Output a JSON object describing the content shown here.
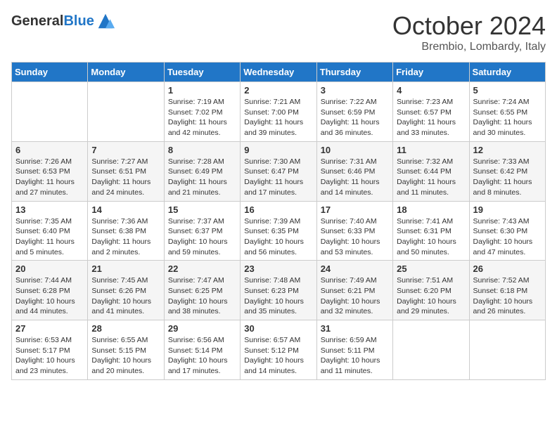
{
  "logo": {
    "general": "General",
    "blue": "Blue"
  },
  "title": "October 2024",
  "location": "Brembio, Lombardy, Italy",
  "days_of_week": [
    "Sunday",
    "Monday",
    "Tuesday",
    "Wednesday",
    "Thursday",
    "Friday",
    "Saturday"
  ],
  "weeks": [
    [
      {
        "day": "",
        "info": ""
      },
      {
        "day": "",
        "info": ""
      },
      {
        "day": "1",
        "info": "Sunrise: 7:19 AM\nSunset: 7:02 PM\nDaylight: 11 hours and 42 minutes."
      },
      {
        "day": "2",
        "info": "Sunrise: 7:21 AM\nSunset: 7:00 PM\nDaylight: 11 hours and 39 minutes."
      },
      {
        "day": "3",
        "info": "Sunrise: 7:22 AM\nSunset: 6:59 PM\nDaylight: 11 hours and 36 minutes."
      },
      {
        "day": "4",
        "info": "Sunrise: 7:23 AM\nSunset: 6:57 PM\nDaylight: 11 hours and 33 minutes."
      },
      {
        "day": "5",
        "info": "Sunrise: 7:24 AM\nSunset: 6:55 PM\nDaylight: 11 hours and 30 minutes."
      }
    ],
    [
      {
        "day": "6",
        "info": "Sunrise: 7:26 AM\nSunset: 6:53 PM\nDaylight: 11 hours and 27 minutes."
      },
      {
        "day": "7",
        "info": "Sunrise: 7:27 AM\nSunset: 6:51 PM\nDaylight: 11 hours and 24 minutes."
      },
      {
        "day": "8",
        "info": "Sunrise: 7:28 AM\nSunset: 6:49 PM\nDaylight: 11 hours and 21 minutes."
      },
      {
        "day": "9",
        "info": "Sunrise: 7:30 AM\nSunset: 6:47 PM\nDaylight: 11 hours and 17 minutes."
      },
      {
        "day": "10",
        "info": "Sunrise: 7:31 AM\nSunset: 6:46 PM\nDaylight: 11 hours and 14 minutes."
      },
      {
        "day": "11",
        "info": "Sunrise: 7:32 AM\nSunset: 6:44 PM\nDaylight: 11 hours and 11 minutes."
      },
      {
        "day": "12",
        "info": "Sunrise: 7:33 AM\nSunset: 6:42 PM\nDaylight: 11 hours and 8 minutes."
      }
    ],
    [
      {
        "day": "13",
        "info": "Sunrise: 7:35 AM\nSunset: 6:40 PM\nDaylight: 11 hours and 5 minutes."
      },
      {
        "day": "14",
        "info": "Sunrise: 7:36 AM\nSunset: 6:38 PM\nDaylight: 11 hours and 2 minutes."
      },
      {
        "day": "15",
        "info": "Sunrise: 7:37 AM\nSunset: 6:37 PM\nDaylight: 10 hours and 59 minutes."
      },
      {
        "day": "16",
        "info": "Sunrise: 7:39 AM\nSunset: 6:35 PM\nDaylight: 10 hours and 56 minutes."
      },
      {
        "day": "17",
        "info": "Sunrise: 7:40 AM\nSunset: 6:33 PM\nDaylight: 10 hours and 53 minutes."
      },
      {
        "day": "18",
        "info": "Sunrise: 7:41 AM\nSunset: 6:31 PM\nDaylight: 10 hours and 50 minutes."
      },
      {
        "day": "19",
        "info": "Sunrise: 7:43 AM\nSunset: 6:30 PM\nDaylight: 10 hours and 47 minutes."
      }
    ],
    [
      {
        "day": "20",
        "info": "Sunrise: 7:44 AM\nSunset: 6:28 PM\nDaylight: 10 hours and 44 minutes."
      },
      {
        "day": "21",
        "info": "Sunrise: 7:45 AM\nSunset: 6:26 PM\nDaylight: 10 hours and 41 minutes."
      },
      {
        "day": "22",
        "info": "Sunrise: 7:47 AM\nSunset: 6:25 PM\nDaylight: 10 hours and 38 minutes."
      },
      {
        "day": "23",
        "info": "Sunrise: 7:48 AM\nSunset: 6:23 PM\nDaylight: 10 hours and 35 minutes."
      },
      {
        "day": "24",
        "info": "Sunrise: 7:49 AM\nSunset: 6:21 PM\nDaylight: 10 hours and 32 minutes."
      },
      {
        "day": "25",
        "info": "Sunrise: 7:51 AM\nSunset: 6:20 PM\nDaylight: 10 hours and 29 minutes."
      },
      {
        "day": "26",
        "info": "Sunrise: 7:52 AM\nSunset: 6:18 PM\nDaylight: 10 hours and 26 minutes."
      }
    ],
    [
      {
        "day": "27",
        "info": "Sunrise: 6:53 AM\nSunset: 5:17 PM\nDaylight: 10 hours and 23 minutes."
      },
      {
        "day": "28",
        "info": "Sunrise: 6:55 AM\nSunset: 5:15 PM\nDaylight: 10 hours and 20 minutes."
      },
      {
        "day": "29",
        "info": "Sunrise: 6:56 AM\nSunset: 5:14 PM\nDaylight: 10 hours and 17 minutes."
      },
      {
        "day": "30",
        "info": "Sunrise: 6:57 AM\nSunset: 5:12 PM\nDaylight: 10 hours and 14 minutes."
      },
      {
        "day": "31",
        "info": "Sunrise: 6:59 AM\nSunset: 5:11 PM\nDaylight: 10 hours and 11 minutes."
      },
      {
        "day": "",
        "info": ""
      },
      {
        "day": "",
        "info": ""
      }
    ]
  ]
}
